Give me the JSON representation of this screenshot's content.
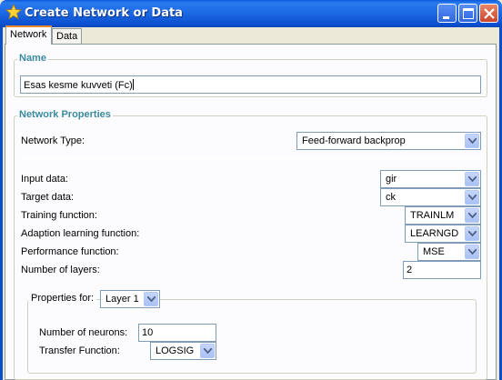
{
  "window": {
    "title": "Create Network or Data"
  },
  "tabs": [
    {
      "label": "Network"
    },
    {
      "label": "Data"
    }
  ],
  "name_group": {
    "legend": "Name",
    "value": "Esas kesme kuvveti (Fc)"
  },
  "props_group": {
    "legend": "Network Properties",
    "network_type": {
      "label": "Network Type:",
      "value": "Feed-forward backprop"
    },
    "input_data": {
      "label": "Input data:",
      "value": "gir"
    },
    "target_data": {
      "label": "Target data:",
      "value": "ck"
    },
    "training_function": {
      "label": "Training function:",
      "value": "TRAINLM"
    },
    "adaption_function": {
      "label": "Adaption learning function:",
      "value": "LEARNGD"
    },
    "performance_function": {
      "label": "Performance function:",
      "value": "MSE"
    },
    "num_layers": {
      "label": "Number of layers:",
      "value": "2"
    },
    "layer_props": {
      "label": "Properties for:",
      "layer": "Layer 1",
      "num_neurons": {
        "label": "Number of neurons:",
        "value": "10"
      },
      "transfer_function": {
        "label": "Transfer Function:",
        "value": "LOGSIG"
      }
    }
  },
  "colors": {
    "titlebar": "#0a5ad8",
    "legend": "#3a8aa0",
    "active_tab_accent": "#e68b2c"
  }
}
